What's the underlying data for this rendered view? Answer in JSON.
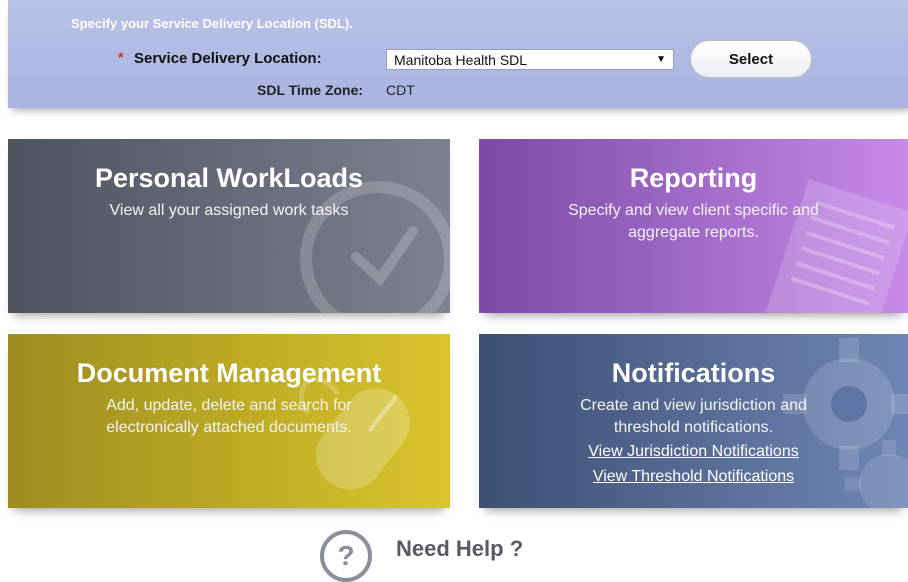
{
  "sdl": {
    "heading": "Specify your Service Delivery Location (SDL).",
    "required_marker": "*",
    "location_label": "Service Delivery Location:",
    "selected_location": "Manitoba Health SDL",
    "select_button": "Select",
    "timezone_label": "SDL Time Zone:",
    "timezone_value": "CDT"
  },
  "tiles": {
    "workloads": {
      "title": "Personal WorkLoads",
      "description": "View all your assigned work tasks"
    },
    "reporting": {
      "title": "Reporting",
      "description_line1": "Specify and view client specific and",
      "description_line2": "aggregate reports."
    },
    "documents": {
      "title": "Document Management",
      "description_line1": "Add, update, delete and search for",
      "description_line2": "electronically attached documents."
    },
    "notifications": {
      "title": "Notifications",
      "description_line1": "Create and view jurisdiction and",
      "description_line2": "threshold notifications.",
      "link_jurisdiction": "View Jurisdiction Notifications",
      "link_threshold": "View Threshold Notifications"
    }
  },
  "help": {
    "icon_glyph": "?",
    "title": "Need Help ?"
  },
  "icons": [
    "clock-icon",
    "document-icon",
    "mouse-icon",
    "gear-icon",
    "help-icon",
    "dropdown-caret-icon"
  ]
}
